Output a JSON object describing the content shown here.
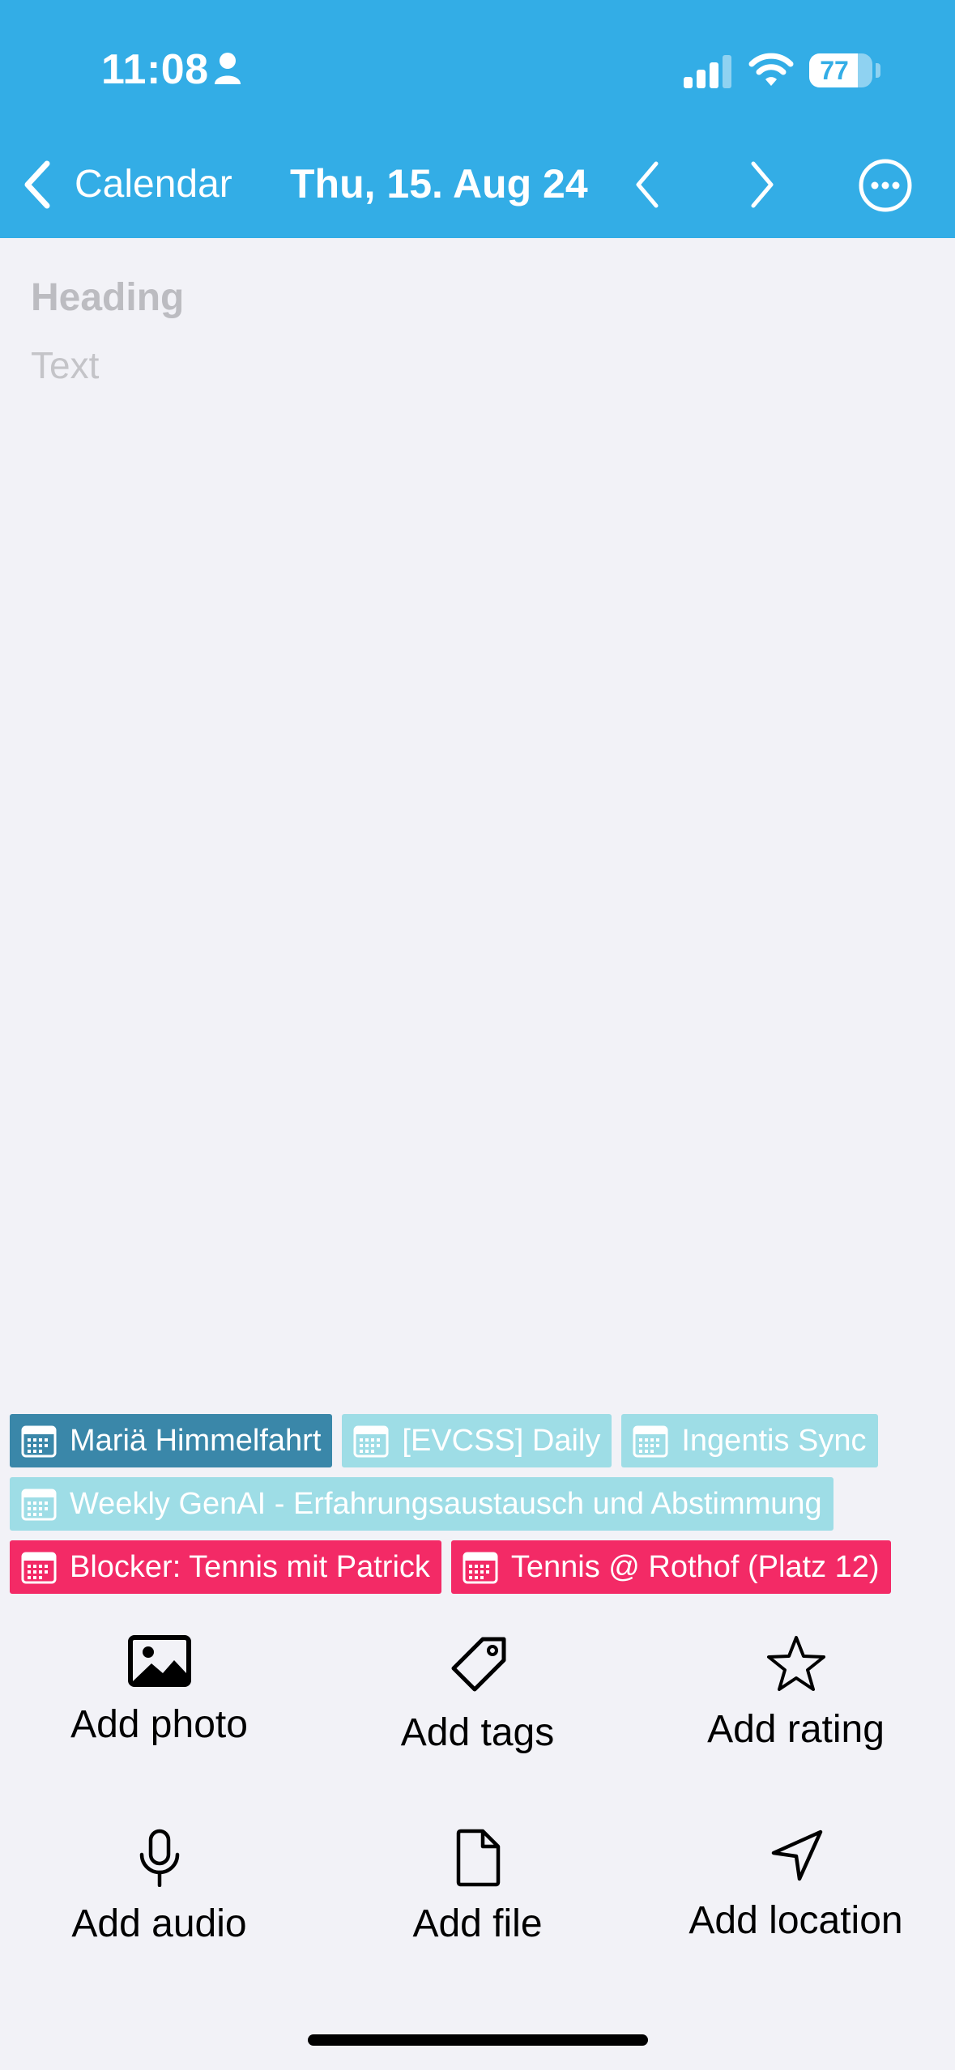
{
  "status_bar": {
    "time": "11:08",
    "battery": "77",
    "battery_level_percent": 77
  },
  "nav": {
    "back_label": "Calendar",
    "title": "Thu, 15. Aug 24"
  },
  "editor": {
    "heading_placeholder": "Heading",
    "text_placeholder": "Text"
  },
  "events": [
    {
      "label": "Mariä Himmelfahrt",
      "color": "#3a87a9"
    },
    {
      "label": "[EVCSS] Daily",
      "color": "#9edde6"
    },
    {
      "label": "Ingentis Sync",
      "color": "#9edde6"
    },
    {
      "label": "Weekly GenAI - Erfahrungsaustausch und Abstimmung",
      "color": "#9edde6"
    },
    {
      "label": "Blocker: Tennis mit Patrick",
      "color": "#f32a66"
    },
    {
      "label": "Tennis @ Rothof (Platz 12)",
      "color": "#f32a66"
    }
  ],
  "actions": {
    "photo": "Add photo",
    "tags": "Add tags",
    "rating": "Add rating",
    "audio": "Add audio",
    "file": "Add file",
    "location": "Add location"
  },
  "colors": {
    "accent": "#33ade6",
    "background": "#f2f2f7"
  },
  "icons": [
    "person-icon",
    "signal-icon",
    "wifi-icon",
    "battery-icon",
    "chevron-left-icon",
    "chevron-right-icon",
    "more-icon",
    "calendar-icon",
    "photo-icon",
    "tag-icon",
    "star-icon",
    "microphone-icon",
    "file-icon",
    "location-arrow-icon"
  ]
}
